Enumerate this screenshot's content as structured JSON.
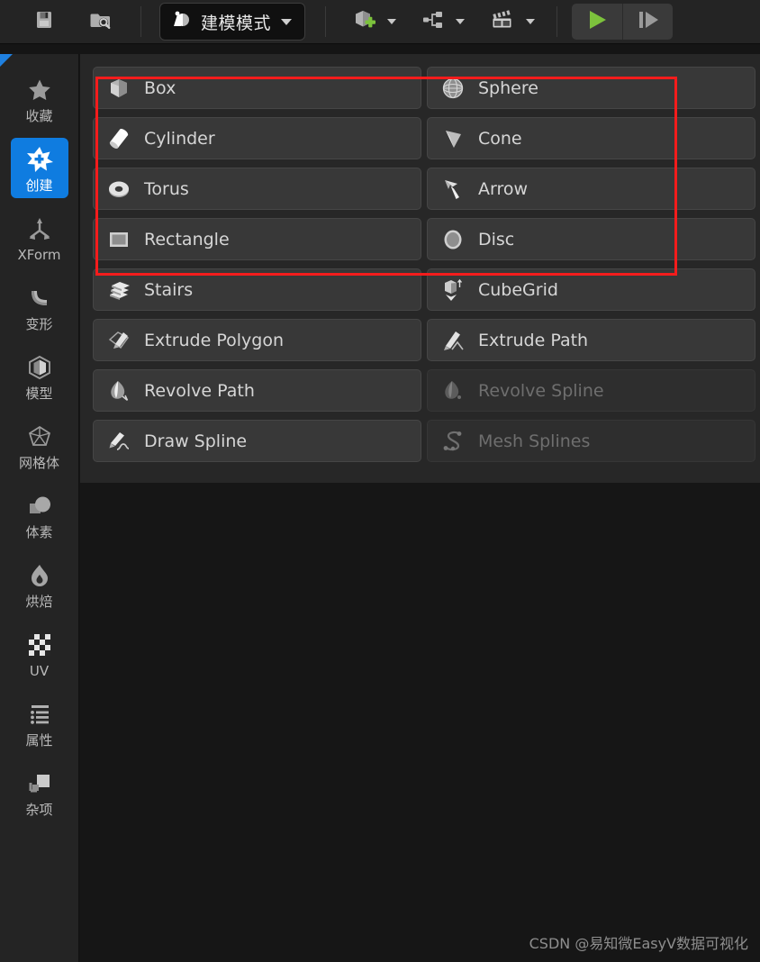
{
  "toolbar": {
    "save": {
      "label": "Save",
      "icon": "save-floppy-icon"
    },
    "browse": {
      "label": "Browse",
      "icon": "folder-search-icon"
    },
    "mode": {
      "label": "建模模式",
      "icon": "modeling-mode-icon"
    },
    "add_content": {
      "label": "Add",
      "icon": "add-cube-plus-icon"
    },
    "blueprints": {
      "label": "Blueprints",
      "icon": "blueprint-node-icon"
    },
    "cinematics": {
      "label": "Cinematics",
      "icon": "clapperboard-icon"
    },
    "play": {
      "label": "Play",
      "icon": "play-triangle-icon"
    },
    "skip": {
      "label": "Skip",
      "icon": "skip-step-icon"
    }
  },
  "sidebar": {
    "items": [
      {
        "label": "收藏",
        "icon": "star-icon",
        "active": false
      },
      {
        "label": "创建",
        "icon": "create-star-icon",
        "active": true
      },
      {
        "label": "XForm",
        "icon": "axis-gizmo-icon",
        "active": false
      },
      {
        "label": "变形",
        "icon": "deform-bend-icon",
        "active": false
      },
      {
        "label": "模型",
        "icon": "model-hex-icon",
        "active": false
      },
      {
        "label": "网格体",
        "icon": "mesh-polyhedron-icon",
        "active": false
      },
      {
        "label": "体素",
        "icon": "voxel-blob-icon",
        "active": false
      },
      {
        "label": "烘焙",
        "icon": "bake-flame-icon",
        "active": false
      },
      {
        "label": "UV",
        "icon": "uv-checker-icon",
        "active": false
      },
      {
        "label": "属性",
        "icon": "attributes-list-icon",
        "active": false
      },
      {
        "label": "杂项",
        "icon": "misc-squares-icon",
        "active": false
      }
    ]
  },
  "tools": {
    "rows": [
      [
        {
          "label": "Box",
          "icon": "box-icon",
          "enabled": true,
          "placeholder": false
        },
        {
          "label": "Sphere",
          "icon": "sphere-icon",
          "enabled": true,
          "placeholder": false
        },
        {
          "label": "",
          "icon": "",
          "enabled": true,
          "placeholder": true
        }
      ],
      [
        {
          "label": "Cylinder",
          "icon": "cylinder-icon",
          "enabled": true,
          "placeholder": false
        },
        {
          "label": "Cone",
          "icon": "cone-icon",
          "enabled": true,
          "placeholder": false
        },
        {
          "label": "",
          "icon": "",
          "enabled": true,
          "placeholder": true
        }
      ],
      [
        {
          "label": "Torus",
          "icon": "torus-icon",
          "enabled": true,
          "placeholder": false
        },
        {
          "label": "Arrow",
          "icon": "arrow-icon",
          "enabled": true,
          "placeholder": false
        },
        {
          "label": "",
          "icon": "",
          "enabled": true,
          "placeholder": true
        }
      ],
      [
        {
          "label": "Rectangle",
          "icon": "rectangle-icon",
          "enabled": true,
          "placeholder": false
        },
        {
          "label": "Disc",
          "icon": "disc-icon",
          "enabled": true,
          "placeholder": false
        },
        {
          "label": "",
          "icon": "",
          "enabled": true,
          "placeholder": true
        }
      ],
      [
        {
          "label": "Stairs",
          "icon": "stairs-icon",
          "enabled": true,
          "placeholder": false
        },
        {
          "label": "CubeGrid",
          "icon": "cubegrid-icon",
          "enabled": true,
          "placeholder": false
        },
        {
          "label": "",
          "icon": "",
          "enabled": true,
          "placeholder": true
        }
      ],
      [
        {
          "label": "Extrude Polygon",
          "icon": "extrude-polygon-icon",
          "enabled": true,
          "placeholder": false
        },
        {
          "label": "Extrude Path",
          "icon": "extrude-path-icon",
          "enabled": true,
          "placeholder": false
        },
        {
          "label": "",
          "icon": "",
          "enabled": true,
          "placeholder": true
        }
      ],
      [
        {
          "label": "Revolve Path",
          "icon": "revolve-path-icon",
          "enabled": true,
          "placeholder": false
        },
        {
          "label": "Revolve Spline",
          "icon": "revolve-spline-icon",
          "enabled": false,
          "placeholder": false
        },
        {
          "label": "",
          "icon": "",
          "enabled": true,
          "placeholder": true
        }
      ],
      [
        {
          "label": "Draw Spline",
          "icon": "draw-spline-icon",
          "enabled": true,
          "placeholder": false
        },
        {
          "label": "Mesh Splines",
          "icon": "mesh-splines-icon",
          "enabled": false,
          "placeholder": false
        },
        {
          "label": "",
          "icon": "",
          "enabled": true,
          "placeholder": true
        }
      ]
    ]
  },
  "annotation": {
    "shape": "red-rectangle",
    "color": "#f41c1c"
  },
  "watermark": {
    "text": "CSDN @易知微EasyV数据可视化"
  },
  "colors": {
    "accent_blue": "#0f7ce0",
    "annotation_red": "#f41c1c",
    "play_green": "#7cc23c",
    "toolbar_bg": "#242424",
    "panel_bg": "#272727",
    "button_bg": "#383838"
  }
}
